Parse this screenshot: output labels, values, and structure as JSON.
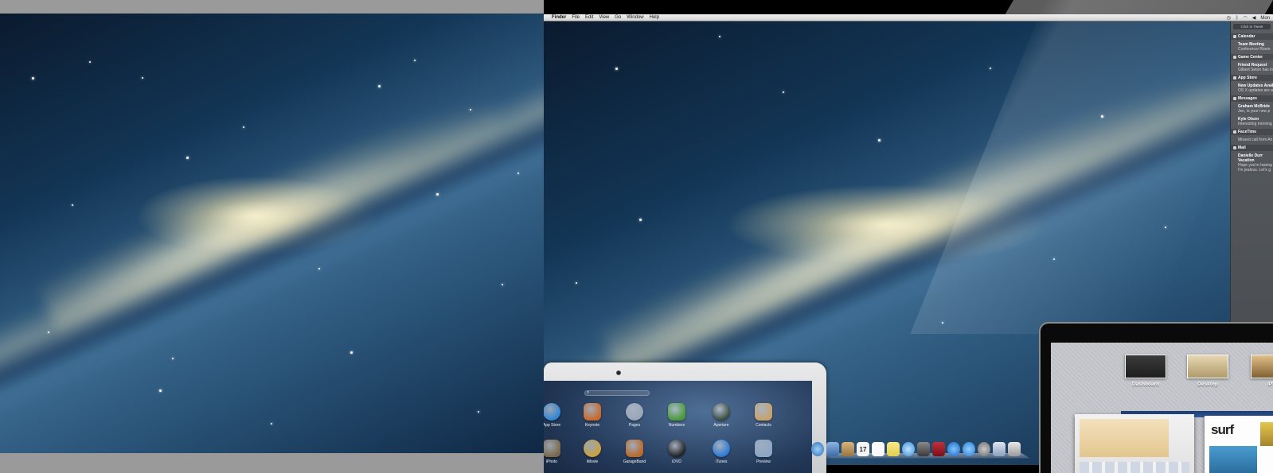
{
  "menubar": {
    "apple_glyph": "",
    "items": [
      "Finder",
      "File",
      "Edit",
      "View",
      "Go",
      "Window",
      "Help"
    ],
    "user_name": "Mon"
  },
  "notification_center": {
    "button_label": "Click to Tweet",
    "sections": [
      {
        "app": "Calendar",
        "items": [
          {
            "title": "Team Meeting",
            "subtitle": "Conference Room"
          }
        ]
      },
      {
        "app": "Game Center",
        "items": [
          {
            "title": "Friend Request",
            "subtitle": "Gilbert Seton has in"
          }
        ]
      },
      {
        "app": "App Store",
        "items": [
          {
            "title": "New Updates Avail",
            "subtitle": "OS X updates are av"
          }
        ]
      },
      {
        "app": "Messages",
        "items": [
          {
            "title": "Graham McBride",
            "subtitle": "Jen, is your new p"
          },
          {
            "title": "Kyle Olson",
            "subtitle": "Interesting morning"
          }
        ]
      },
      {
        "app": "FaceTime",
        "items": [
          {
            "title": "",
            "subtitle": "Missed call from An"
          }
        ]
      },
      {
        "app": "Mail",
        "items": [
          {
            "title": "Danielle Durr",
            "subtitle": "Vacation"
          },
          {
            "title": "",
            "subtitle": "Hope you're having"
          },
          {
            "title": "",
            "subtitle": "I'm jealous. Let's g"
          }
        ]
      }
    ]
  },
  "launchpad": {
    "apps": [
      {
        "label": "App Store",
        "color": "#2f86d6",
        "round": true
      },
      {
        "label": "Keynote",
        "color": "#c96a2c",
        "round": false
      },
      {
        "label": "Pages",
        "color": "#9aa6b8",
        "round": true
      },
      {
        "label": "Numbers",
        "color": "#4a9a3b",
        "round": false
      },
      {
        "label": "Aperture",
        "color": "#3b4d3e",
        "round": true
      },
      {
        "label": "Contacts",
        "color": "#c7a26a",
        "round": false
      },
      {
        "label": "iPhoto",
        "color": "#7a6a4a",
        "round": false
      },
      {
        "label": "iMovie",
        "color": "#c9a23a",
        "round": true
      },
      {
        "label": "GarageBand",
        "color": "#b86a2a",
        "round": false
      },
      {
        "label": "iDVD",
        "color": "#222222",
        "round": true
      },
      {
        "label": "iTunes",
        "color": "#2a7ad6",
        "round": true
      },
      {
        "label": "Preview",
        "color": "#8aa6c8",
        "round": false
      }
    ]
  },
  "mission_control": {
    "spaces": [
      "Dashboard",
      "Desktop",
      "iPh"
    ],
    "window_text": "surf"
  },
  "dock": {
    "icons": [
      "safari-icon",
      "mail-icon",
      "contacts-icon",
      "calendar-icon",
      "reminders-icon",
      "notes-icon",
      "messages-icon",
      "facetime-icon",
      "photo-booth-icon",
      "itunes-icon",
      "app-store-icon",
      "system-preferences-icon",
      "preview-icon",
      "trash-icon"
    ],
    "calendar_day": "17"
  }
}
